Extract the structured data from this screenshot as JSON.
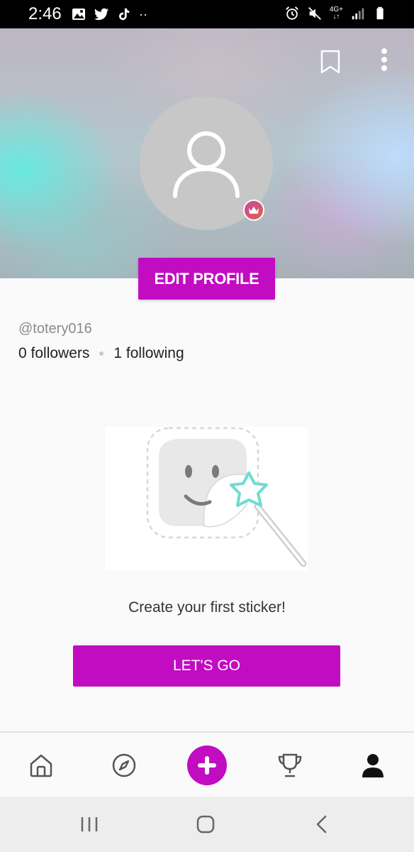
{
  "status_bar": {
    "time": "2:46",
    "network_label": "4G+",
    "left_icons": [
      "gallery-icon",
      "twitter-icon",
      "tiktok-icon",
      "more-notifications-icon"
    ],
    "right_icons": [
      "alarm-icon",
      "mute-icon",
      "network-icon",
      "signal-icon",
      "battery-icon"
    ]
  },
  "header": {
    "bookmark_icon": "bookmark-icon",
    "more_icon": "more-vertical-icon",
    "avatar_icon": "user-placeholder-icon",
    "badge_icon": "crown-icon",
    "edit_profile_label": "EDIT PROFILE"
  },
  "profile": {
    "username": "@totery016",
    "followers": "0 followers",
    "following": "1 following"
  },
  "empty_state": {
    "illustration_icon": "sticker-magic-wand-icon",
    "message": "Create your first sticker!",
    "cta_label": "LET'S GO"
  },
  "bottom_nav": {
    "items": [
      {
        "name": "home",
        "icon": "home-icon"
      },
      {
        "name": "explore",
        "icon": "compass-icon"
      },
      {
        "name": "create",
        "icon": "plus-icon"
      },
      {
        "name": "challenges",
        "icon": "trophy-icon"
      },
      {
        "name": "profile",
        "icon": "person-icon"
      }
    ]
  },
  "system_nav": [
    "recents-icon",
    "home-circle-icon",
    "back-icon"
  ],
  "colors": {
    "accent": "#c20cc2",
    "status_bar_bg": "#000000",
    "avatar_bg": "#c7c7c7",
    "page_bg": "#fafafa"
  }
}
